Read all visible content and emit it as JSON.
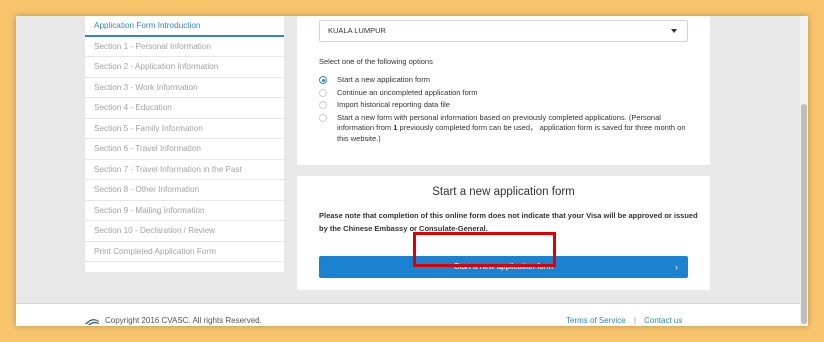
{
  "sidebar": {
    "items": [
      {
        "label": "Application Form Introduction"
      },
      {
        "label": "Section 1 - Personal Information"
      },
      {
        "label": "Section 2 - Application Information"
      },
      {
        "label": "Section 3 - Work Information"
      },
      {
        "label": "Section 4 - Education"
      },
      {
        "label": "Section 5 - Family Information"
      },
      {
        "label": "Section 6 - Travel Information"
      },
      {
        "label": "Section 7 - Travel Information in the Past"
      },
      {
        "label": "Section 8 - Other Information"
      },
      {
        "label": "Section 9 - Mailing Information"
      },
      {
        "label": "Section 10 - Declaration / Review"
      },
      {
        "label": "Print Completed Application Form"
      }
    ]
  },
  "location_select": {
    "value": "KUALA LUMPUR"
  },
  "options_card": {
    "prompt": "Select one of the following options",
    "options": [
      {
        "label": "Start a new application form",
        "selected": true
      },
      {
        "label": "Continue an uncompleted application form",
        "selected": false
      },
      {
        "label": "Import historical reporting data file",
        "selected": false
      },
      {
        "label_pre": "Start a new form with personal information based on previously completed applications. (Personal information from ",
        "label_num": "1",
        "label_post": " previously completed form can be used， application form is saved for three month on this website.)",
        "selected": false
      }
    ]
  },
  "start_card": {
    "title": "Start a new application form",
    "note": "Please note that completion of this online form does not indicate that your Visa will be approved or issued by the Chinese Embassy or Consulate-General.",
    "button_label": "Start a new application form",
    "button_chevron": "›"
  },
  "footer": {
    "copyright": "Copyright 2016 CVASC. All rights Reserved.",
    "terms": "Terms of Service",
    "separator": "|",
    "contact": "Contact us"
  },
  "colors": {
    "accent": "#1a82d0",
    "link": "#2f86c9",
    "highlight": "#e00000",
    "background": "#f7c46c"
  }
}
